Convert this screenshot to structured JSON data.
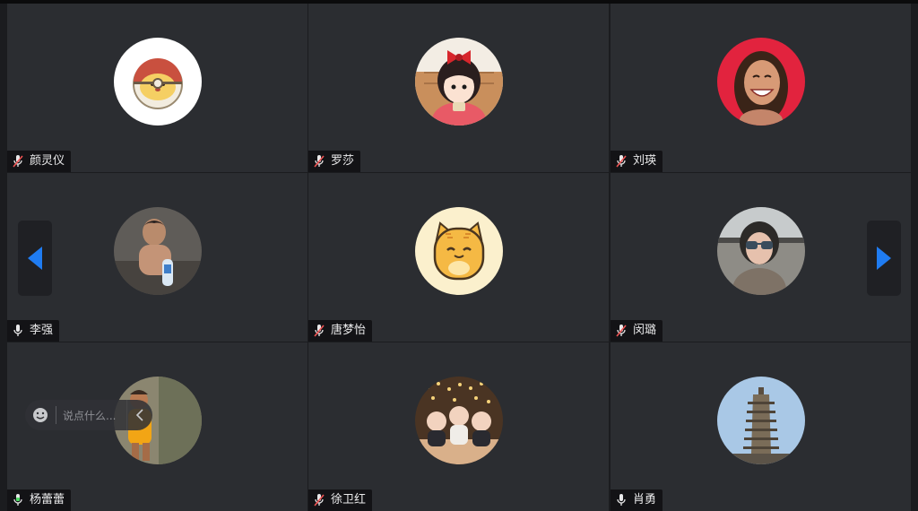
{
  "participants": [
    {
      "name": "颜灵仪",
      "mic": "muted",
      "avatar": "pokeball-pikachu-avatar"
    },
    {
      "name": "罗莎",
      "mic": "muted",
      "avatar": "anime-girl-red-bow-avatar"
    },
    {
      "name": "刘瑛",
      "mic": "muted",
      "avatar": "smiling-woman-illustration-avatar"
    },
    {
      "name": "李强",
      "mic": "on",
      "avatar": "child-photo-avatar"
    },
    {
      "name": "唐梦怡",
      "mic": "muted",
      "avatar": "orange-cat-cartoon-avatar"
    },
    {
      "name": "闵璐",
      "mic": "muted",
      "avatar": "woman-sunglasses-car-avatar"
    },
    {
      "name": "杨蕾蕾",
      "mic": "speaking",
      "avatar": "child-yellow-shirt-avatar"
    },
    {
      "name": "徐卫红",
      "mic": "muted",
      "avatar": "three-babies-photo-avatar"
    },
    {
      "name": "肖勇",
      "mic": "on",
      "avatar": "pagoda-photo-avatar"
    }
  ],
  "navigation": {
    "prev_icon": "chevron-left-icon",
    "next_icon": "chevron-right-icon",
    "accent_color": "#1f7cf2"
  },
  "chat": {
    "placeholder": "说点什么...",
    "emoji_icon": "emoji-icon",
    "collapse_icon": "chevron-left-icon"
  },
  "colors": {
    "tile_bg": "#2b2d31",
    "muted_mic": "#f05454",
    "speaking_mic": "#4cd964"
  }
}
